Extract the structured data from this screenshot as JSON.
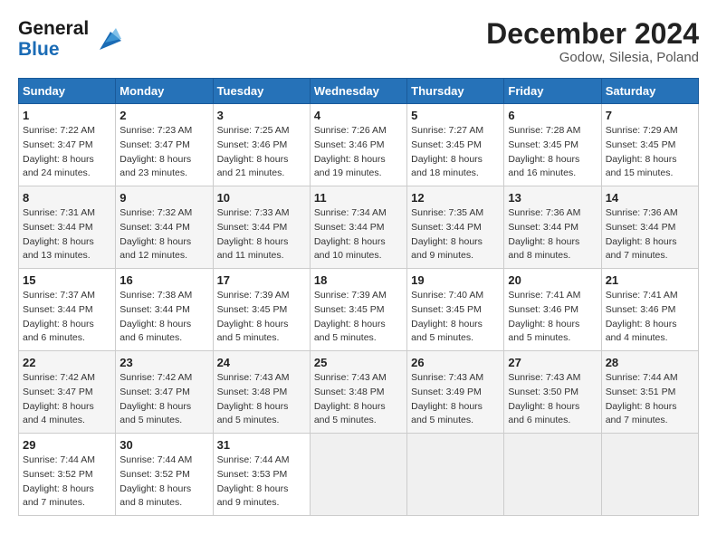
{
  "header": {
    "logo": {
      "line1": "General",
      "line2": "Blue"
    },
    "title": "December 2024",
    "subtitle": "Godow, Silesia, Poland"
  },
  "calendar": {
    "days_of_week": [
      "Sunday",
      "Monday",
      "Tuesday",
      "Wednesday",
      "Thursday",
      "Friday",
      "Saturday"
    ],
    "weeks": [
      [
        {
          "day": 1,
          "sunrise": "Sunrise: 7:22 AM",
          "sunset": "Sunset: 3:47 PM",
          "daylight": "Daylight: 8 hours and 24 minutes."
        },
        {
          "day": 2,
          "sunrise": "Sunrise: 7:23 AM",
          "sunset": "Sunset: 3:47 PM",
          "daylight": "Daylight: 8 hours and 23 minutes."
        },
        {
          "day": 3,
          "sunrise": "Sunrise: 7:25 AM",
          "sunset": "Sunset: 3:46 PM",
          "daylight": "Daylight: 8 hours and 21 minutes."
        },
        {
          "day": 4,
          "sunrise": "Sunrise: 7:26 AM",
          "sunset": "Sunset: 3:46 PM",
          "daylight": "Daylight: 8 hours and 19 minutes."
        },
        {
          "day": 5,
          "sunrise": "Sunrise: 7:27 AM",
          "sunset": "Sunset: 3:45 PM",
          "daylight": "Daylight: 8 hours and 18 minutes."
        },
        {
          "day": 6,
          "sunrise": "Sunrise: 7:28 AM",
          "sunset": "Sunset: 3:45 PM",
          "daylight": "Daylight: 8 hours and 16 minutes."
        },
        {
          "day": 7,
          "sunrise": "Sunrise: 7:29 AM",
          "sunset": "Sunset: 3:45 PM",
          "daylight": "Daylight: 8 hours and 15 minutes."
        }
      ],
      [
        {
          "day": 8,
          "sunrise": "Sunrise: 7:31 AM",
          "sunset": "Sunset: 3:44 PM",
          "daylight": "Daylight: 8 hours and 13 minutes."
        },
        {
          "day": 9,
          "sunrise": "Sunrise: 7:32 AM",
          "sunset": "Sunset: 3:44 PM",
          "daylight": "Daylight: 8 hours and 12 minutes."
        },
        {
          "day": 10,
          "sunrise": "Sunrise: 7:33 AM",
          "sunset": "Sunset: 3:44 PM",
          "daylight": "Daylight: 8 hours and 11 minutes."
        },
        {
          "day": 11,
          "sunrise": "Sunrise: 7:34 AM",
          "sunset": "Sunset: 3:44 PM",
          "daylight": "Daylight: 8 hours and 10 minutes."
        },
        {
          "day": 12,
          "sunrise": "Sunrise: 7:35 AM",
          "sunset": "Sunset: 3:44 PM",
          "daylight": "Daylight: 8 hours and 9 minutes."
        },
        {
          "day": 13,
          "sunrise": "Sunrise: 7:36 AM",
          "sunset": "Sunset: 3:44 PM",
          "daylight": "Daylight: 8 hours and 8 minutes."
        },
        {
          "day": 14,
          "sunrise": "Sunrise: 7:36 AM",
          "sunset": "Sunset: 3:44 PM",
          "daylight": "Daylight: 8 hours and 7 minutes."
        }
      ],
      [
        {
          "day": 15,
          "sunrise": "Sunrise: 7:37 AM",
          "sunset": "Sunset: 3:44 PM",
          "daylight": "Daylight: 8 hours and 6 minutes."
        },
        {
          "day": 16,
          "sunrise": "Sunrise: 7:38 AM",
          "sunset": "Sunset: 3:44 PM",
          "daylight": "Daylight: 8 hours and 6 minutes."
        },
        {
          "day": 17,
          "sunrise": "Sunrise: 7:39 AM",
          "sunset": "Sunset: 3:45 PM",
          "daylight": "Daylight: 8 hours and 5 minutes."
        },
        {
          "day": 18,
          "sunrise": "Sunrise: 7:39 AM",
          "sunset": "Sunset: 3:45 PM",
          "daylight": "Daylight: 8 hours and 5 minutes."
        },
        {
          "day": 19,
          "sunrise": "Sunrise: 7:40 AM",
          "sunset": "Sunset: 3:45 PM",
          "daylight": "Daylight: 8 hours and 5 minutes."
        },
        {
          "day": 20,
          "sunrise": "Sunrise: 7:41 AM",
          "sunset": "Sunset: 3:46 PM",
          "daylight": "Daylight: 8 hours and 5 minutes."
        },
        {
          "day": 21,
          "sunrise": "Sunrise: 7:41 AM",
          "sunset": "Sunset: 3:46 PM",
          "daylight": "Daylight: 8 hours and 4 minutes."
        }
      ],
      [
        {
          "day": 22,
          "sunrise": "Sunrise: 7:42 AM",
          "sunset": "Sunset: 3:47 PM",
          "daylight": "Daylight: 8 hours and 4 minutes."
        },
        {
          "day": 23,
          "sunrise": "Sunrise: 7:42 AM",
          "sunset": "Sunset: 3:47 PM",
          "daylight": "Daylight: 8 hours and 5 minutes."
        },
        {
          "day": 24,
          "sunrise": "Sunrise: 7:43 AM",
          "sunset": "Sunset: 3:48 PM",
          "daylight": "Daylight: 8 hours and 5 minutes."
        },
        {
          "day": 25,
          "sunrise": "Sunrise: 7:43 AM",
          "sunset": "Sunset: 3:48 PM",
          "daylight": "Daylight: 8 hours and 5 minutes."
        },
        {
          "day": 26,
          "sunrise": "Sunrise: 7:43 AM",
          "sunset": "Sunset: 3:49 PM",
          "daylight": "Daylight: 8 hours and 5 minutes."
        },
        {
          "day": 27,
          "sunrise": "Sunrise: 7:43 AM",
          "sunset": "Sunset: 3:50 PM",
          "daylight": "Daylight: 8 hours and 6 minutes."
        },
        {
          "day": 28,
          "sunrise": "Sunrise: 7:44 AM",
          "sunset": "Sunset: 3:51 PM",
          "daylight": "Daylight: 8 hours and 7 minutes."
        }
      ],
      [
        {
          "day": 29,
          "sunrise": "Sunrise: 7:44 AM",
          "sunset": "Sunset: 3:52 PM",
          "daylight": "Daylight: 8 hours and 7 minutes."
        },
        {
          "day": 30,
          "sunrise": "Sunrise: 7:44 AM",
          "sunset": "Sunset: 3:52 PM",
          "daylight": "Daylight: 8 hours and 8 minutes."
        },
        {
          "day": 31,
          "sunrise": "Sunrise: 7:44 AM",
          "sunset": "Sunset: 3:53 PM",
          "daylight": "Daylight: 8 hours and 9 minutes."
        },
        null,
        null,
        null,
        null
      ]
    ]
  }
}
